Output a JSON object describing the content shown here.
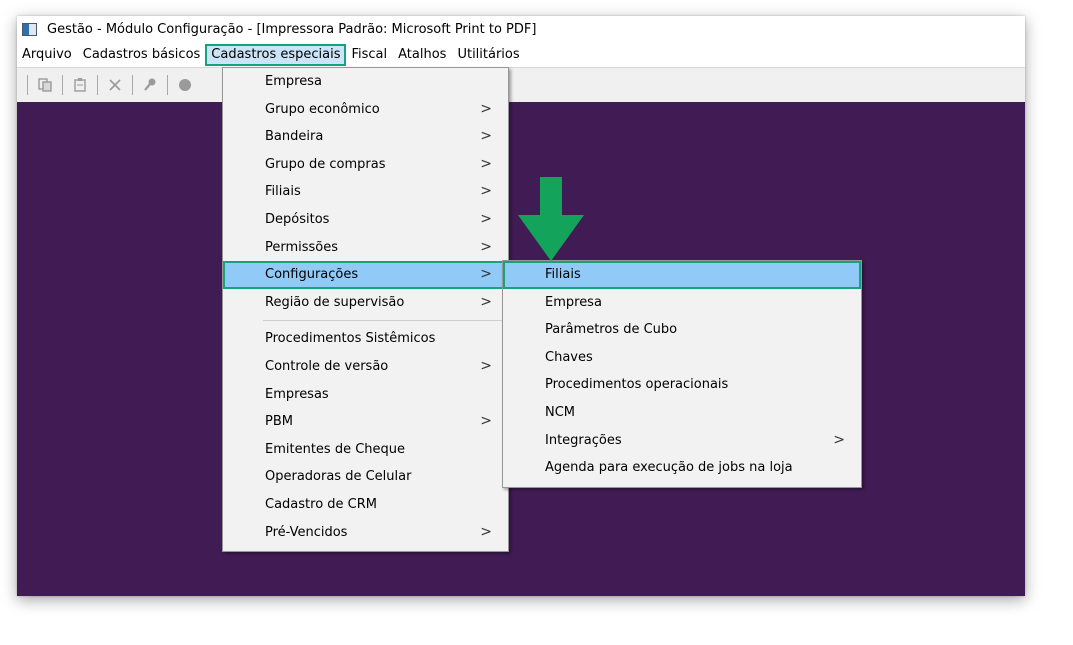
{
  "window": {
    "title": "Gestão  - Módulo Configuração - [Impressora Padrão: Microsoft Print to PDF]"
  },
  "menubar": {
    "items": [
      {
        "label": "Arquivo"
      },
      {
        "label": "Cadastros básicos"
      },
      {
        "label": "Cadastros especiais"
      },
      {
        "label": "Fiscal"
      },
      {
        "label": "Atalhos"
      },
      {
        "label": "Utilitários"
      }
    ],
    "active_index": 2
  },
  "toolbar": {
    "buttons": [
      "copy-icon",
      "paste-icon",
      "delete-icon",
      "key-icon",
      "record-icon"
    ]
  },
  "dropdown_main": {
    "items": [
      {
        "label": "Empresa",
        "submenu": false
      },
      {
        "label": "Grupo econômico",
        "submenu": true
      },
      {
        "label": "Bandeira",
        "submenu": true
      },
      {
        "label": "Grupo de compras",
        "submenu": true
      },
      {
        "label": "Filiais",
        "submenu": true
      },
      {
        "label": "Depósitos",
        "submenu": true
      },
      {
        "label": "Permissões",
        "submenu": true
      },
      {
        "label": "Configurações",
        "submenu": true,
        "highlighted": true
      },
      {
        "label": "Região de supervisão",
        "submenu": true
      },
      {
        "label": "Procedimentos Sistêmicos",
        "submenu": false
      },
      {
        "label": "Controle de versão",
        "submenu": true
      },
      {
        "label": "Empresas",
        "submenu": false
      },
      {
        "label": "PBM",
        "submenu": true
      },
      {
        "label": "Emitentes de Cheque",
        "submenu": false
      },
      {
        "label": "Operadoras de Celular",
        "submenu": false
      },
      {
        "label": "Cadastro de CRM",
        "submenu": false
      },
      {
        "label": "Pré-Vencidos",
        "submenu": true
      }
    ],
    "chevron": ">"
  },
  "dropdown_sub": {
    "items": [
      {
        "label": "Filiais",
        "submenu": false,
        "highlighted": true
      },
      {
        "label": "Empresa",
        "submenu": false
      },
      {
        "label": "Parâmetros de Cubo",
        "submenu": false
      },
      {
        "label": "Chaves",
        "submenu": false
      },
      {
        "label": "Procedimentos operacionais",
        "submenu": false
      },
      {
        "label": "NCM",
        "submenu": false
      },
      {
        "label": "Integrações",
        "submenu": true
      },
      {
        "label": "Agenda para execução de jobs na loja",
        "submenu": false
      }
    ]
  },
  "colors": {
    "workspace": "#411c54",
    "highlight_border": "#14a37f",
    "highlight_fill": "#91c9f7",
    "arrow": "#14a35a"
  }
}
